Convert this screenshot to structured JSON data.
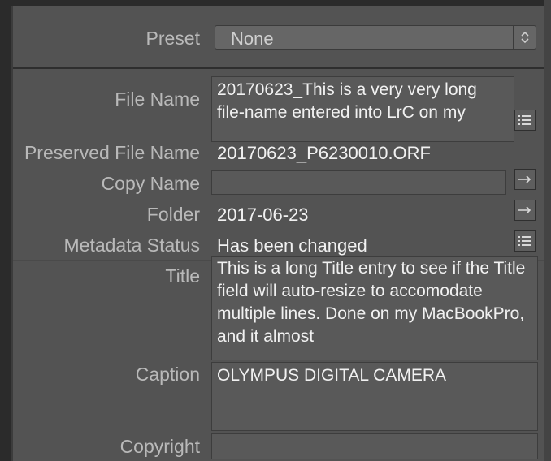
{
  "preset": {
    "label": "Preset",
    "value": "None"
  },
  "fields": {
    "file_name": {
      "label": "File Name",
      "value": "20170623_This is a very very long file-name entered into LrC on my"
    },
    "preserved_file_name": {
      "label": "Preserved File Name",
      "value": "20170623_P6230010.ORF"
    },
    "copy_name": {
      "label": "Copy Name",
      "value": ""
    },
    "folder": {
      "label": "Folder",
      "value": "2017-06-23"
    },
    "metadata_status": {
      "label": "Metadata Status",
      "value": "Has been changed"
    },
    "title": {
      "label": "Title",
      "value": "This is a long Title entry to see if the Title field will auto-resize to accomodate multiple lines. Done on my MacBookPro, and it almost"
    },
    "caption": {
      "label": "Caption",
      "value": "OLYMPUS DIGITAL CAMERA"
    },
    "copyright": {
      "label": "Copyright",
      "value": ""
    }
  },
  "icons": {
    "list": "list-icon",
    "go_to": "arrow-right-icon",
    "select": "up-down-chevron-icon"
  }
}
